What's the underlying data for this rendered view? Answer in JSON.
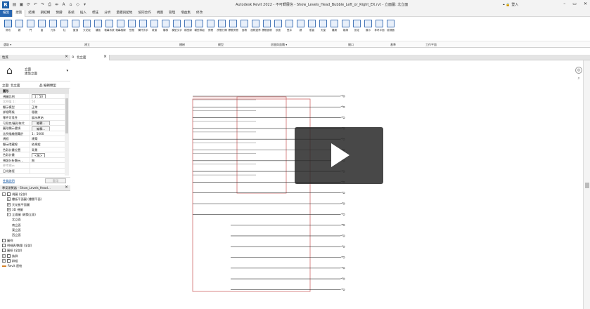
{
  "titlebar": {
    "logo": "R",
    "title": "Autodesk Revit 2022 - 不可轉展信 - Show_Levels_Head_Bubble_Left_or_Right_EX.rvt - 立面圖: 北立面",
    "user": "⌖ 🔒 登入",
    "qat_icons": [
      "folder-icon",
      "save-icon",
      "sync-icon",
      "undo-icon",
      "redo-icon",
      "print-icon",
      "measure-icon",
      "text-icon",
      "3d-icon",
      "section-icon",
      "switch-icon"
    ]
  },
  "ribbon_tabs": [
    "檔案",
    "建築",
    "結構",
    "鋼結構",
    "預鑄",
    "系統",
    "插入",
    "標註",
    "分析",
    "量體與配地",
    "協同合作",
    "視圖",
    "管理",
    "增益集",
    "修改"
  ],
  "ribbon_tools": [
    {
      "name": "select-tool",
      "label": "修改"
    },
    {
      "name": "wall-tool",
      "label": "牆"
    },
    {
      "name": "door-tool",
      "label": "門"
    },
    {
      "name": "window-tool",
      "label": "窗"
    },
    {
      "name": "component-tool",
      "label": "元件"
    },
    {
      "name": "column-tool",
      "label": "柱"
    },
    {
      "name": "roof-tool",
      "label": "屋頂"
    },
    {
      "name": "ceiling-tool",
      "label": "天花板"
    },
    {
      "name": "floor-tool",
      "label": "樓板"
    },
    {
      "name": "curtain-system-tool",
      "label": "帷幕系統"
    },
    {
      "name": "curtain-grid-tool",
      "label": "帷幕格線"
    },
    {
      "name": "mullion-tool",
      "label": "豎框"
    },
    {
      "name": "railing-tool",
      "label": "欄杆扶手"
    },
    {
      "name": "ramp-tool",
      "label": "坡道"
    },
    {
      "name": "stair-tool",
      "label": "樓梯"
    },
    {
      "name": "model-text-tool",
      "label": "模型文字"
    },
    {
      "name": "model-line-tool",
      "label": "模型線"
    },
    {
      "name": "model-group-tool",
      "label": "模型群組"
    },
    {
      "name": "room-tool",
      "label": "房間"
    },
    {
      "name": "room-separator-tool",
      "label": "房間分隔"
    },
    {
      "name": "tag-room-tool",
      "label": "標籤房間"
    },
    {
      "name": "area-tool",
      "label": "面積"
    },
    {
      "name": "area-boundary-tool",
      "label": "面積邊界"
    },
    {
      "name": "tag-area-tool",
      "label": "標籤面積"
    },
    {
      "name": "by-face-tool",
      "label": "依面"
    },
    {
      "name": "shaft-tool",
      "label": "豎井"
    },
    {
      "name": "wall-opening-tool",
      "label": "牆"
    },
    {
      "name": "vertical-tool",
      "label": "垂直"
    },
    {
      "name": "dormer-tool",
      "label": "天窗"
    },
    {
      "name": "level-tool",
      "label": "樓層"
    },
    {
      "name": "grid-tool",
      "label": "格線"
    },
    {
      "name": "set-tool",
      "label": "設定"
    },
    {
      "name": "show-tool",
      "label": "展示"
    },
    {
      "name": "ref-plane-tool",
      "label": "參考平面"
    },
    {
      "name": "viewer-tool",
      "label": "檢視器"
    }
  ],
  "panel_labels": [
    "選取 ▾",
    "建立",
    "樓梯",
    "模型",
    "房間與面積 ▾",
    "開口",
    "基準",
    "工作平面"
  ],
  "properties": {
    "title": "性質",
    "type_line1": "立面",
    "type_line2": "建築立面",
    "instance": "立面: 北立面",
    "edit_type": "品 編輯類型",
    "help": "性質說明",
    "apply": "套用",
    "rows": [
      {
        "k": "圖形",
        "v": "",
        "head": true
      },
      {
        "k": "視圖比例",
        "v": "1 : 50",
        "box": true
      },
      {
        "k": "比例值 1:",
        "v": "50",
        "dim": true
      },
      {
        "k": "顯示模型",
        "v": "正常"
      },
      {
        "k": "詳細等級",
        "v": "粗糙"
      },
      {
        "k": "零件可見性",
        "v": "展示原始"
      },
      {
        "k": "可見性/圖形取代",
        "v": "編輯...",
        "btn": true
      },
      {
        "k": "圖形顯示選項",
        "v": "編輯...",
        "btn": true
      },
      {
        "k": "比例描繪隱藏於",
        "v": "1 : 5000"
      },
      {
        "k": "規程",
        "v": "建築"
      },
      {
        "k": "顯示隱藏線",
        "v": "依規程"
      },
      {
        "k": "色彩計畫位置",
        "v": "背景"
      },
      {
        "k": "色彩計畫",
        "v": "<無>",
        "box": true
      },
      {
        "k": "預設分析顯示...",
        "v": "無"
      },
      {
        "k": "參考標示",
        "v": "",
        "dim": true
      },
      {
        "k": "日光路徑",
        "v": ""
      }
    ]
  },
  "project_browser": {
    "title": "專案瀏覽器 - Show_Levels_Head...",
    "items": [
      {
        "indent": 0,
        "tg": "-",
        "icon": "views-icon",
        "label": "視圖 (全部)"
      },
      {
        "indent": 1,
        "tg": "+",
        "label": "樓板平面圖 (樓層平面)"
      },
      {
        "indent": 1,
        "tg": "+",
        "label": "天花板平面圖"
      },
      {
        "indent": 1,
        "tg": "+",
        "label": "3D 視圖"
      },
      {
        "indent": 1,
        "tg": "-",
        "label": "立面圖 (建築立面)"
      },
      {
        "indent": 2,
        "label": "北立面"
      },
      {
        "indent": 2,
        "label": "南立面"
      },
      {
        "indent": 2,
        "label": "東立面"
      },
      {
        "indent": 2,
        "label": "西立面"
      },
      {
        "indent": 0,
        "icon": "legend-icon",
        "label": "圖例"
      },
      {
        "indent": 0,
        "icon": "schedule-icon",
        "label": "明細表/數量 (全部)"
      },
      {
        "indent": 0,
        "icon": "sheet-icon",
        "label": "圖紙 (全部)"
      },
      {
        "indent": 0,
        "tg": "+",
        "icon": "family-icon",
        "label": "族群"
      },
      {
        "indent": 0,
        "tg": "+",
        "icon": "group-icon",
        "label": "群組"
      },
      {
        "indent": 0,
        "icon": "link-icon",
        "label": "Revit 連結"
      }
    ]
  },
  "document": {
    "tab_icon": "home-icon",
    "tab_label": "北立面"
  },
  "canvas": {
    "level_count": 19
  }
}
